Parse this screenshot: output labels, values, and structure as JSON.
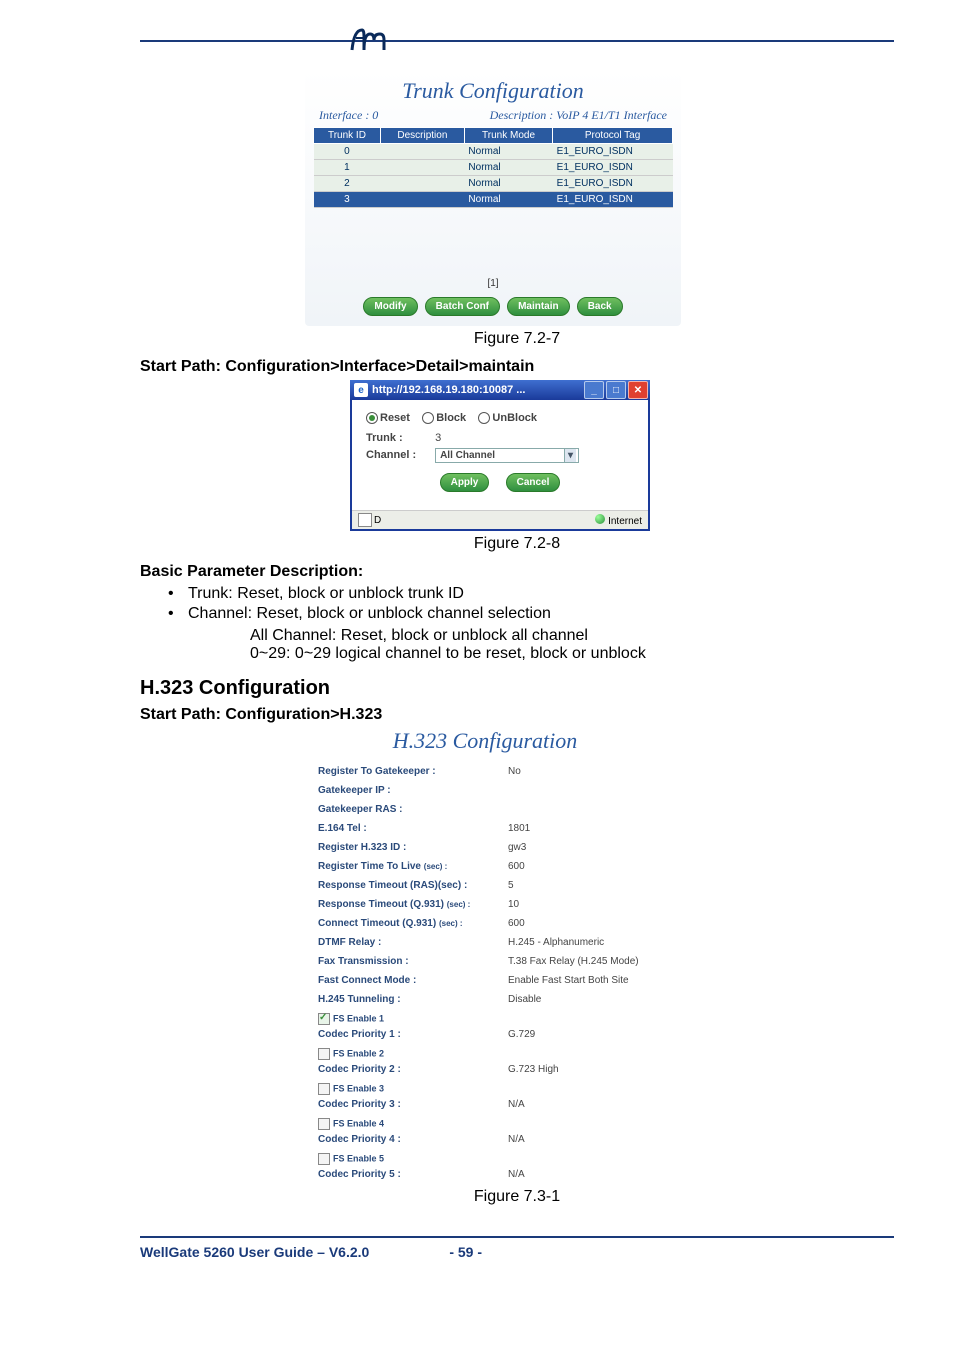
{
  "logo_alt": "fm",
  "panel1": {
    "title": "Trunk Configuration",
    "sub_left": "Interface : 0",
    "sub_right": "Description : VoIP 4 E1/T1 Interface",
    "headers": [
      "Trunk ID",
      "Description",
      "Trunk Mode",
      "Protocol Tag"
    ],
    "rows": [
      {
        "id": "0",
        "desc": "",
        "mode": "Normal",
        "tag": "E1_EURO_ISDN"
      },
      {
        "id": "1",
        "desc": "",
        "mode": "Normal",
        "tag": "E1_EURO_ISDN"
      },
      {
        "id": "2",
        "desc": "",
        "mode": "Normal",
        "tag": "E1_EURO_ISDN"
      },
      {
        "id": "3",
        "desc": "",
        "mode": "Normal",
        "tag": "E1_EURO_ISDN"
      }
    ],
    "page_indicator": "[1]",
    "buttons": {
      "modify": "Modify",
      "batch": "Batch Conf",
      "maintain": "Maintain",
      "back": "Back"
    }
  },
  "caption1": "Figure 7.2-7",
  "start_path_1": "Start Path: Configuration>Interface>Detail>maintain",
  "dialog": {
    "title": "http://192.168.19.180:10087 ...",
    "radios": {
      "reset": "Reset",
      "block": "Block",
      "unblock": "UnBlock"
    },
    "trunk_label": "Trunk :",
    "trunk_value": "3",
    "channel_label": "Channel :",
    "channel_value": "All Channel",
    "apply": "Apply",
    "cancel": "Cancel",
    "status_left": "D",
    "status_right": "Internet"
  },
  "caption2": "Figure 7.2-8",
  "basic_param_heading": "Basic Parameter Description:",
  "bullets": {
    "b1": "Trunk: Reset, block or unblock trunk ID",
    "b2": "Channel: Reset, block or unblock channel selection",
    "sub1": "All Channel: Reset, block or unblock all channel",
    "sub2": "0~29: 0~29 logical channel to be reset, block or unblock"
  },
  "h323_heading": "H.323 Configuration",
  "start_path_2": "Start Path: Configuration>H.323",
  "panel2": {
    "title": "H.323 Configuration",
    "rows": [
      {
        "k": "Register To Gatekeeper :",
        "v": "No"
      },
      {
        "k": "Gatekeeper IP :",
        "v": ""
      },
      {
        "k": "Gatekeeper RAS :",
        "v": ""
      },
      {
        "k": "E.164 Tel :",
        "v": "1801"
      },
      {
        "k": "Register H.323 ID :",
        "v": "gw3"
      },
      {
        "k": "Register Time To Live",
        "ksmall": "(sec) :",
        "v": "600"
      },
      {
        "k": "Response Timeout (RAS)(sec) :",
        "v": "5"
      },
      {
        "k": "Response Timeout (Q.931)",
        "ksmall": "(sec) :",
        "v": "10"
      },
      {
        "k": "Connect Timeout (Q.931)",
        "ksmall": "(sec) :",
        "v": "600"
      },
      {
        "k": "DTMF Relay :",
        "v": "H.245 - Alphanumeric"
      },
      {
        "k": "Fax Transmission :",
        "v": "T.38 Fax Relay (H.245 Mode)"
      },
      {
        "k": "Fast Connect Mode :",
        "v": "Enable Fast Start Both Site"
      },
      {
        "k": "H.245 Tunneling :",
        "v": "Disable"
      }
    ],
    "codecs": [
      {
        "fs": "FS Enable 1",
        "checked": true,
        "k": "Codec Priority 1 :",
        "v": "G.729"
      },
      {
        "fs": "FS Enable 2",
        "checked": false,
        "k": "Codec Priority 2 :",
        "v": "G.723 High"
      },
      {
        "fs": "FS Enable 3",
        "checked": false,
        "k": "Codec Priority 3 :",
        "v": "N/A"
      },
      {
        "fs": "FS Enable 4",
        "checked": false,
        "k": "Codec Priority 4 :",
        "v": "N/A"
      },
      {
        "fs": "FS Enable 5",
        "checked": false,
        "k": "Codec Priority 5 :",
        "v": "N/A"
      }
    ]
  },
  "caption3": "Figure 7.3-1",
  "footer": {
    "doc": "WellGate 5260 User Guide – V6.2.0",
    "page": "- 59 -"
  }
}
